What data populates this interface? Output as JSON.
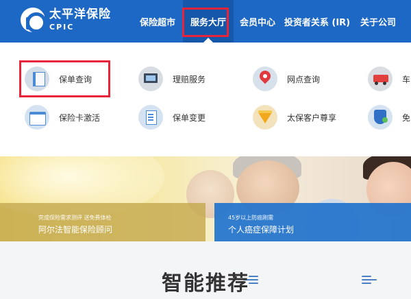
{
  "brand": {
    "name_cn": "太平洋保险",
    "name_en": "CPIC",
    "primary_color": "#1d68c4",
    "highlight_color": "#e8233a"
  },
  "nav": [
    {
      "label": "保险超市"
    },
    {
      "label": "服务大厅",
      "active": true
    },
    {
      "label": "会员中心"
    },
    {
      "label": "投资者关系 (IR)"
    },
    {
      "label": "关于公司"
    }
  ],
  "services": [
    {
      "label": "保单查询",
      "icon": "policy-document-icon"
    },
    {
      "label": "理赔服务",
      "icon": "claims-computer-icon"
    },
    {
      "label": "网点查询",
      "icon": "location-pin-icon"
    },
    {
      "label": "车",
      "icon": "car-truck-icon"
    },
    {
      "label": "保险卡激活",
      "icon": "card-icon"
    },
    {
      "label": "保单变更",
      "icon": "document-edit-icon"
    },
    {
      "label": "太保客户尊享",
      "icon": "diamond-icon"
    },
    {
      "label": "免",
      "icon": "shield-icon"
    }
  ],
  "banner": {
    "left": {
      "sub": "完成保险需求测评 送免费体检",
      "main": "阿尔法智能保险顾问"
    },
    "right": {
      "sub": "45岁以上防癌刚需",
      "main": "个人癌症保障计划"
    }
  },
  "recommend": {
    "title": "智能推荐"
  }
}
